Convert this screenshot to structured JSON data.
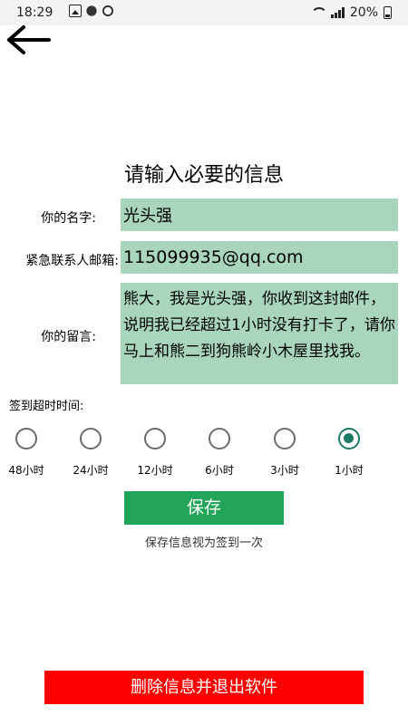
{
  "status_bar": {
    "time": "18:29",
    "battery_text": "20%",
    "icons_left": [
      "photo-icon",
      "generic-app-icon",
      "watch-icon"
    ],
    "icons_right": [
      "wifi-icon",
      "signal-icon",
      "battery-icon"
    ]
  },
  "nav": {
    "back_icon": "arrow-left-icon"
  },
  "form": {
    "title": "请输入必要的信息",
    "name_label": "你的名字:",
    "name_value": "光头强",
    "email_label": "紧急联系人邮箱:",
    "email_value": "115099935@qq.com",
    "message_label": "你的留言:",
    "message_value": "熊大，我是光头强，你收到这封邮件，说明我已经超过1小时没有打卡了，请你马上和熊二到狗熊岭小木屋里找我。",
    "timeout_label": "签到超时时间:",
    "timeout_options": [
      {
        "label": "48小时",
        "selected": false
      },
      {
        "label": "24小时",
        "selected": false
      },
      {
        "label": "12小时",
        "selected": false
      },
      {
        "label": "6小时",
        "selected": false
      },
      {
        "label": "3小时",
        "selected": false
      },
      {
        "label": "1小时",
        "selected": true
      }
    ]
  },
  "actions": {
    "save_label": "保存",
    "save_note": "保存信息视为签到一次",
    "delete_label": "删除信息并退出软件"
  },
  "colors": {
    "field_bg": "#a8d5bb",
    "save_button": "#22a459",
    "delete_button": "#ff0000",
    "radio_checked": "#1d7a64"
  }
}
